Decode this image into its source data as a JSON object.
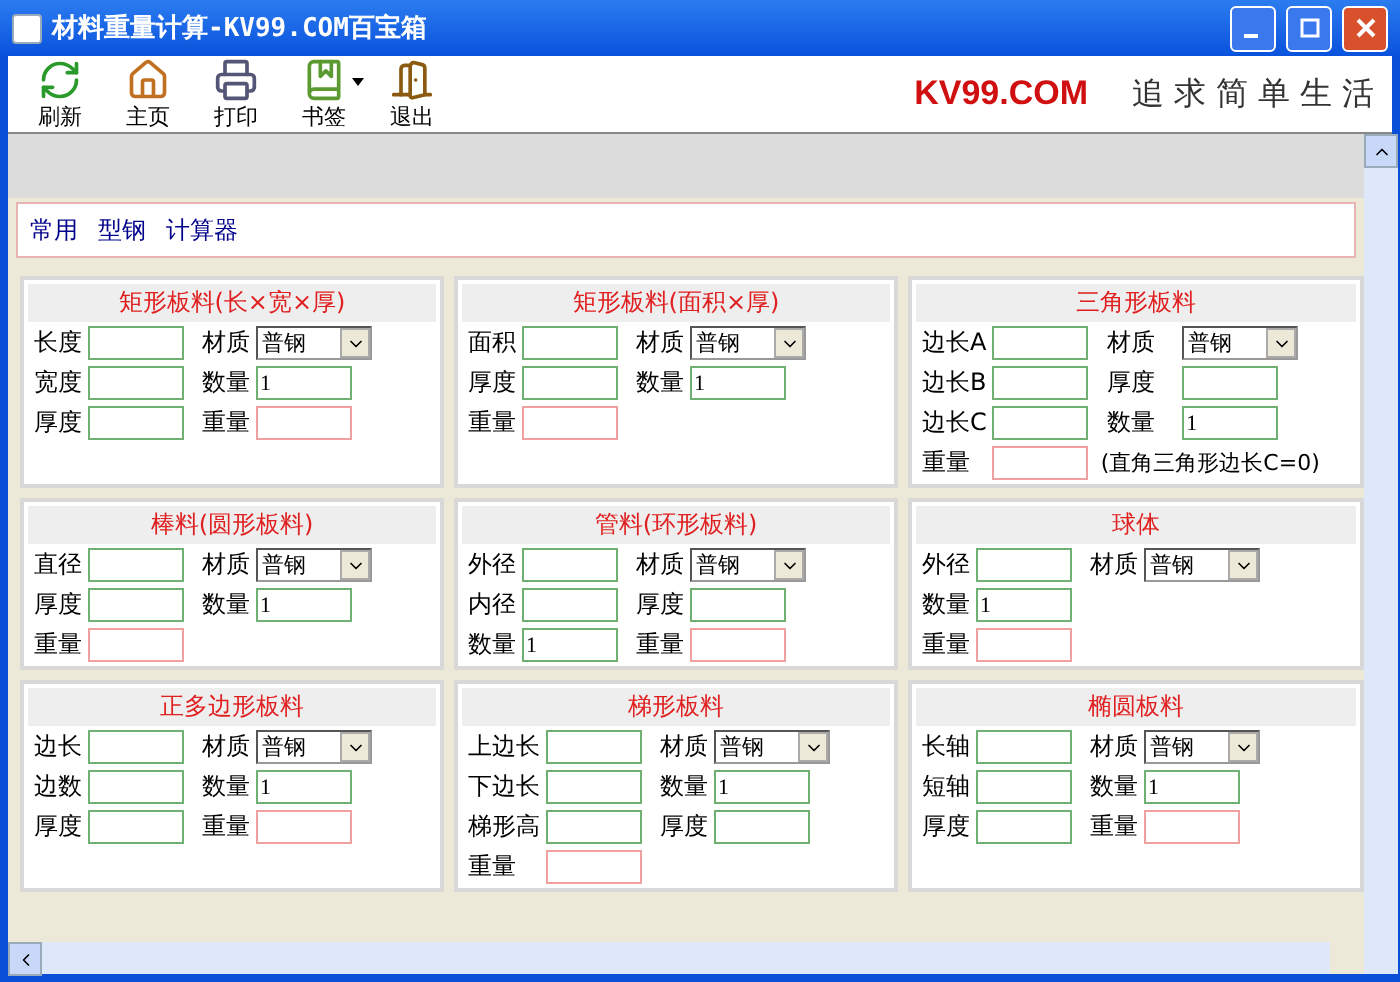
{
  "window": {
    "title": "材料重量计算-KV99.COM百宝箱"
  },
  "toolbar": [
    {
      "label": "刷新",
      "kind": "refresh"
    },
    {
      "label": "主页",
      "kind": "home"
    },
    {
      "label": "打印",
      "kind": "print"
    },
    {
      "label": "书签",
      "kind": "bookmark",
      "dropdown": true
    },
    {
      "label": "退出",
      "kind": "exit"
    }
  ],
  "logo": {
    "brand": "KV99.COM",
    "slogan": "追求简单生活"
  },
  "tabs": [
    {
      "label": "常用"
    },
    {
      "label": "型钢"
    },
    {
      "label": "计算器"
    }
  ],
  "panels": [
    {
      "title": "矩形板料(长×宽×厚)",
      "rows": [
        [
          {
            "label": "长度",
            "kind": "input"
          },
          {
            "label": "材质",
            "kind": "select",
            "value": "普钢"
          }
        ],
        [
          {
            "label": "宽度",
            "kind": "input"
          },
          {
            "label": "数量",
            "kind": "input",
            "value": "1"
          }
        ],
        [
          {
            "label": "厚度",
            "kind": "input"
          },
          {
            "label": "重量",
            "kind": "result"
          }
        ]
      ]
    },
    {
      "title": "矩形板料(面积×厚)",
      "rows": [
        [
          {
            "label": "面积",
            "kind": "input"
          },
          {
            "label": "材质",
            "kind": "select",
            "value": "普钢"
          }
        ],
        [
          {
            "label": "厚度",
            "kind": "input"
          },
          {
            "label": "数量",
            "kind": "input",
            "value": "1"
          }
        ],
        [
          {
            "label": "重量",
            "kind": "result"
          }
        ]
      ]
    },
    {
      "title": "三角形板料",
      "rows": [
        [
          {
            "label": "边长A",
            "kind": "input"
          },
          {
            "label": "材质",
            "kind": "select",
            "value": "普钢"
          }
        ],
        [
          {
            "label": "边长B",
            "kind": "input"
          },
          {
            "label": "厚度",
            "kind": "input"
          }
        ],
        [
          {
            "label": "边长C",
            "kind": "input"
          },
          {
            "label": "数量",
            "kind": "input",
            "value": "1"
          }
        ],
        [
          {
            "label": "重量",
            "kind": "result"
          },
          {
            "kind": "note",
            "text": "(直角三角形边长C=0)"
          }
        ]
      ]
    },
    {
      "title": "棒料(圆形板料)",
      "rows": [
        [
          {
            "label": "直径",
            "kind": "input"
          },
          {
            "label": "材质",
            "kind": "select",
            "value": "普钢"
          }
        ],
        [
          {
            "label": "厚度",
            "kind": "input"
          },
          {
            "label": "数量",
            "kind": "input",
            "value": "1"
          }
        ],
        [
          {
            "label": "重量",
            "kind": "result"
          }
        ]
      ]
    },
    {
      "title": "管料(环形板料)",
      "rows": [
        [
          {
            "label": "外径",
            "kind": "input"
          },
          {
            "label": "材质",
            "kind": "select",
            "value": "普钢"
          }
        ],
        [
          {
            "label": "内径",
            "kind": "input"
          },
          {
            "label": "厚度",
            "kind": "input"
          }
        ],
        [
          {
            "label": "数量",
            "kind": "input",
            "value": "1"
          },
          {
            "label": "重量",
            "kind": "result"
          }
        ]
      ]
    },
    {
      "title": "球体",
      "rows": [
        [
          {
            "label": "外径",
            "kind": "input"
          },
          {
            "label": "材质",
            "kind": "select",
            "value": "普钢"
          }
        ],
        [
          {
            "label": "数量",
            "kind": "input",
            "value": "1"
          }
        ],
        [
          {
            "label": "重量",
            "kind": "result"
          }
        ]
      ]
    },
    {
      "title": "正多边形板料",
      "rows": [
        [
          {
            "label": "边长",
            "kind": "input"
          },
          {
            "label": "材质",
            "kind": "select",
            "value": "普钢"
          }
        ],
        [
          {
            "label": "边数",
            "kind": "input"
          },
          {
            "label": "数量",
            "kind": "input",
            "value": "1"
          }
        ],
        [
          {
            "label": "厚度",
            "kind": "input"
          },
          {
            "label": "重量",
            "kind": "result"
          }
        ]
      ]
    },
    {
      "title": "梯形板料",
      "rows": [
        [
          {
            "label": "上边长",
            "kind": "input"
          },
          {
            "label": "材质",
            "kind": "select",
            "value": "普钢"
          }
        ],
        [
          {
            "label": "下边长",
            "kind": "input"
          },
          {
            "label": "数量",
            "kind": "input",
            "value": "1"
          }
        ],
        [
          {
            "label": "梯形高",
            "kind": "input"
          },
          {
            "label": "厚度",
            "kind": "input"
          }
        ],
        [
          {
            "label": "重量",
            "kind": "result"
          }
        ]
      ]
    },
    {
      "title": "椭圆板料",
      "rows": [
        [
          {
            "label": "长轴",
            "kind": "input"
          },
          {
            "label": "材质",
            "kind": "select",
            "value": "普钢"
          }
        ],
        [
          {
            "label": "短轴",
            "kind": "input"
          },
          {
            "label": "数量",
            "kind": "input",
            "value": "1"
          }
        ],
        [
          {
            "label": "厚度",
            "kind": "input"
          },
          {
            "label": "重量",
            "kind": "result"
          }
        ]
      ]
    }
  ]
}
